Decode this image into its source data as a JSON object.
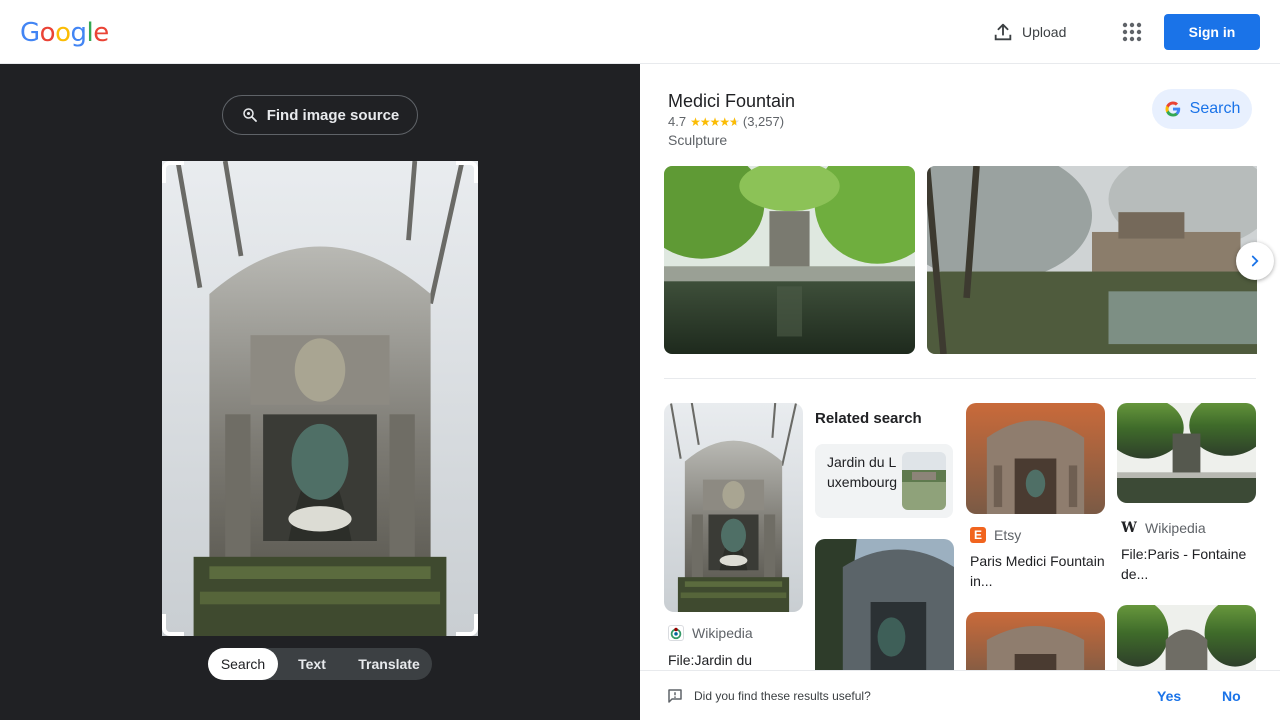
{
  "header": {
    "logo_letters": [
      {
        "ch": "G",
        "color": "#4285F4"
      },
      {
        "ch": "o",
        "color": "#EA4335"
      },
      {
        "ch": "o",
        "color": "#FBBC05"
      },
      {
        "ch": "g",
        "color": "#4285F4"
      },
      {
        "ch": "l",
        "color": "#34A853"
      },
      {
        "ch": "e",
        "color": "#EA4335"
      }
    ],
    "upload_label": "Upload",
    "upload_icon": "upload-icon",
    "apps_icon": "apps-grid-icon",
    "signin_label": "Sign in"
  },
  "left": {
    "find_source_label": "Find image source",
    "find_source_icon": "lens-search-icon",
    "tabs": [
      {
        "label": "Search",
        "active": true
      },
      {
        "label": "Text",
        "active": false
      },
      {
        "label": "Translate",
        "active": false
      }
    ]
  },
  "entity": {
    "title": "Medici Fountain",
    "rating": "4.7",
    "stars": 4.7,
    "reviews": "(3,257)",
    "type": "Sculpture",
    "search_chip_label": "Search"
  },
  "related": {
    "title": "Related search",
    "item_label": "Jardin du Luxembourg"
  },
  "results": [
    {
      "source": "Wikipedia",
      "title": "File:Jardin du"
    },
    {
      "source": "Etsy",
      "title": "Paris Medici Fountain in..."
    },
    {
      "source": "Wikipedia",
      "title": "File:Paris - Fontaine de..."
    }
  ],
  "feedback": {
    "question": "Did you find these results useful?",
    "yes": "Yes",
    "no": "No"
  },
  "colors": {
    "accent": "#1a73e8",
    "dark_panel": "#202124",
    "star": "#fbbc04"
  }
}
